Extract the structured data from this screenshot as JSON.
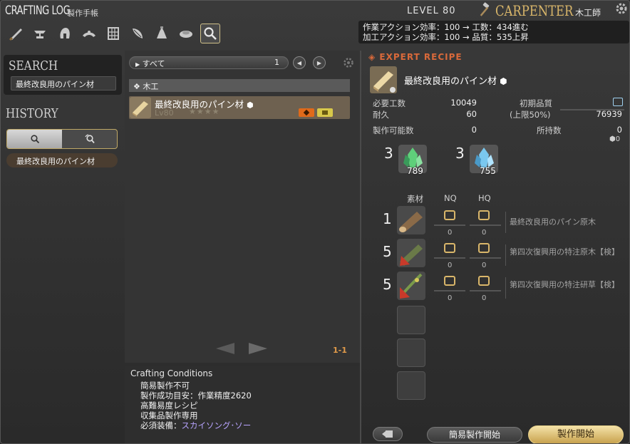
{
  "header": {
    "title_en": "CRAFTING LOG",
    "title_jp": "製作手帳",
    "level": "LEVEL 80",
    "job_en": "CARPENTER",
    "job_jp": "木工師"
  },
  "stats": {
    "line1": "作業アクション効率：100 → 工数：434進む",
    "line2": "加工アクション効率：100 → 品質：535上昇"
  },
  "categories": [
    {
      "icon": "saw-icon"
    },
    {
      "icon": "anvil-icon"
    },
    {
      "icon": "helm-icon"
    },
    {
      "icon": "armor-icon"
    },
    {
      "icon": "loom-icon"
    },
    {
      "icon": "leather-icon"
    },
    {
      "icon": "alembic-icon"
    },
    {
      "icon": "food-icon"
    },
    {
      "icon": "search-icon",
      "active": true
    }
  ],
  "search": {
    "title": "SEARCH",
    "value": "最終改良用のパイン材"
  },
  "history": {
    "title": "HISTORY",
    "items": [
      "最終改良用のパイン材"
    ]
  },
  "list": {
    "filter_label": "すべて",
    "filter_count": "1",
    "group": "木工",
    "recipes": [
      {
        "name": "最終改良用のパイン材",
        "level": "Lv80",
        "stars": "★★★★"
      }
    ],
    "page": "1-1"
  },
  "conditions": {
    "title": "Crafting Conditions",
    "lines": [
      "簡易製作不可",
      "製作成功目安：作業精度2620",
      "高難易度レシピ",
      "収集品製作専用"
    ],
    "equip_label": "必須装備：",
    "equip_value": "スカイソング･ソー"
  },
  "recipe": {
    "tag": "EXPERT RECIPE",
    "name": "最終改良用のパイン材",
    "progress_label": "必要工数",
    "progress_value": "10049",
    "durability_label": "耐久",
    "durability_value": "60",
    "initial_quality_label": "初期品質",
    "quality_cap_label": "(上限50%)",
    "quality_cap_value": "76939",
    "craftable_label": "製作可能数",
    "craftable_value": "0",
    "owned_label": "所持数",
    "owned_value": "0",
    "owned_hq": "0"
  },
  "crystals": [
    {
      "qty": "3",
      "have": "789",
      "icon": "wind-crystal-icon"
    },
    {
      "qty": "3",
      "have": "755",
      "icon": "ice-crystal-icon"
    }
  ],
  "materials": {
    "header_mat": "素材",
    "header_nq": "NQ",
    "header_hq": "HQ",
    "rows": [
      {
        "qty": "1",
        "nq": "0",
        "hq": "0",
        "name": "最終改良用のパイン原木",
        "icon": "pine-log-icon"
      },
      {
        "qty": "5",
        "nq": "0",
        "hq": "0",
        "name": "第四次復興用の特注原木【検】",
        "icon": "custom-log-icon"
      },
      {
        "qty": "5",
        "nq": "0",
        "hq": "0",
        "name": "第四次復興用の特注研草【検】",
        "icon": "custom-herb-icon"
      }
    ]
  },
  "buttons": {
    "quick_synth": "簡易製作開始",
    "synth": "製作開始"
  }
}
